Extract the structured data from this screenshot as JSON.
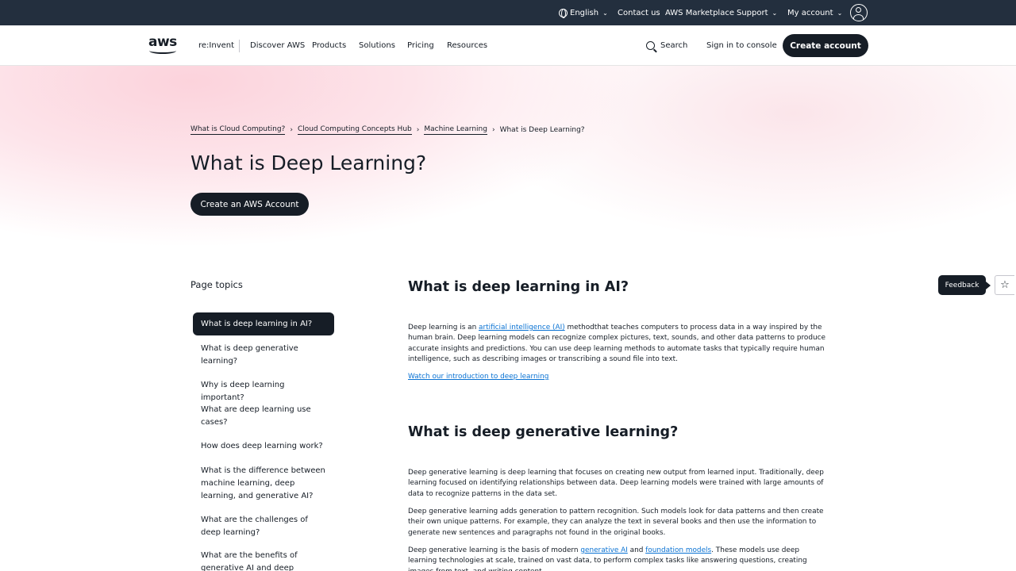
{
  "utility_bar": {
    "language": "English",
    "contact": "Contact us",
    "marketplace": "AWS Marketplace",
    "support": "Support",
    "account": "My account"
  },
  "nav": {
    "logo_text": "aws",
    "items": [
      "re:Invent",
      "Discover AWS",
      "Products",
      "Solutions",
      "Pricing",
      "Resources"
    ],
    "search": "Search",
    "sign_in": "Sign in to console",
    "create_account": "Create account"
  },
  "breadcrumb": [
    "What is Cloud Computing?",
    "Cloud Computing Concepts Hub",
    "Machine Learning",
    "What is Deep Learning?"
  ],
  "hero": {
    "title": "What is Deep Learning?",
    "cta": "Create an AWS Account"
  },
  "sidebar": {
    "heading": "Page topics",
    "topics": [
      "What is deep learning in AI?",
      "What is deep generative learning?",
      "Why is deep learning important?",
      "What are deep learning use cases?",
      "How does deep learning work?",
      "What is the difference between machine learning, deep learning, and generative AI?",
      "What are the challenges of deep learning?",
      "What are the benefits of generative AI and deep learning"
    ]
  },
  "content": {
    "section1": {
      "heading": "What is deep learning in AI?",
      "p1_before": "Deep learning is an ",
      "p1_link": "artificial intelligence (AI)",
      "p1_after": " methodthat teaches computers to process data in a way inspired by the human brain. Deep learning models can recognize complex pictures, text, sounds, and other data patterns to produce accurate insights and predictions. You can use deep learning methods to automate tasks that typically require human intelligence, such as describing images or transcribing a sound file into text.",
      "video_link": "Watch our introduction to deep learning"
    },
    "section2": {
      "heading": "What is deep generative learning?",
      "p1": "Deep generative learning is deep learning that focuses on creating new output from learned input. Traditionally, deep learning focused on identifying relationships between data. Deep learning models were trained with large amounts of data to recognize patterns in the data set.",
      "p2": "Deep generative learning adds generation to pattern recognition. Such models look for data patterns and then create their own unique patterns. For example, they can analyze the text in several books and then use the information to generate new sentences and paragraphs not found in the original books.",
      "p3_before": "Deep generative learning is the basis of modern ",
      "p3_link1": "generative AI",
      "p3_mid": " and ",
      "p3_link2": "foundation models",
      "p3_after": ". These models use deep learning technologies at scale, trained on vast data, to perform complex tasks like answering questions, creating images from text, and writing content."
    }
  },
  "feedback": {
    "label": "Feedback",
    "star_icon": "☆"
  }
}
